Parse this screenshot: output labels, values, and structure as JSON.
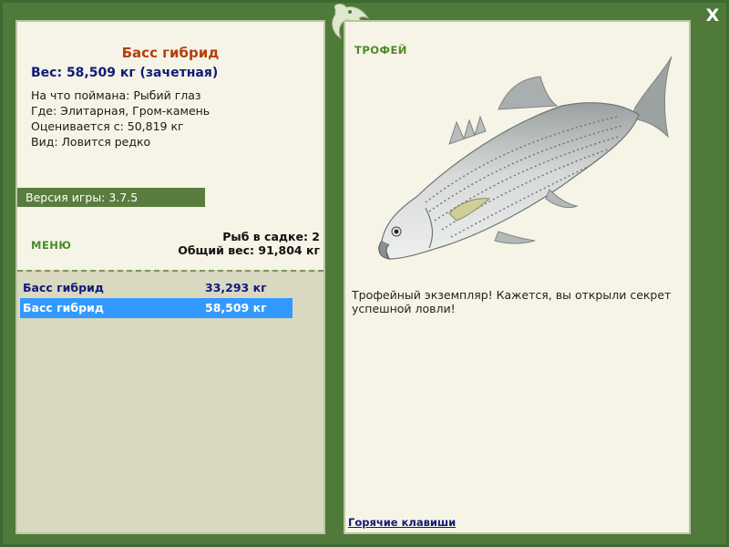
{
  "window": {
    "close_label": "X"
  },
  "fish": {
    "name": "Басс гибрид",
    "weight_line": "Вес: 58,509 кг (зачетная)",
    "bait_line": "На что поймана: Рыбий глаз",
    "location_line": "Где: Элитарная, Гром-камень",
    "threshold_line": "Оценивается с: 50,819 кг",
    "rarity_line": "Вид: Ловится редко"
  },
  "version": {
    "label": "Версия игры: 3.7.5"
  },
  "menu": {
    "label": "МЕНЮ"
  },
  "keepnet": {
    "count_line": "Рыб в садке: 2",
    "total_line": "Общий вес: 91,804 кг"
  },
  "catches": [
    {
      "name": "Басс гибрид",
      "weight": "33,293 кг",
      "selected": false
    },
    {
      "name": "Басс гибрид",
      "weight": "58,509 кг",
      "selected": true
    }
  ],
  "trophy": {
    "label": "ТРОФЕЙ",
    "description": "Трофейный экземпляр! Кажется, вы открыли секрет успешной ловли!"
  },
  "footer": {
    "hotkeys_label": "Горячие клавиши"
  },
  "colors": {
    "frame": "#4f7a3a",
    "panel_bg": "#f5f4e6",
    "list_bg": "#d9d8c0",
    "title": "#b5400c",
    "navy": "#101a7a",
    "accent_green": "#4b8a2a",
    "selection": "#3399ff"
  },
  "icons": {
    "logo": "fish-logo-icon",
    "close": "close-icon"
  }
}
